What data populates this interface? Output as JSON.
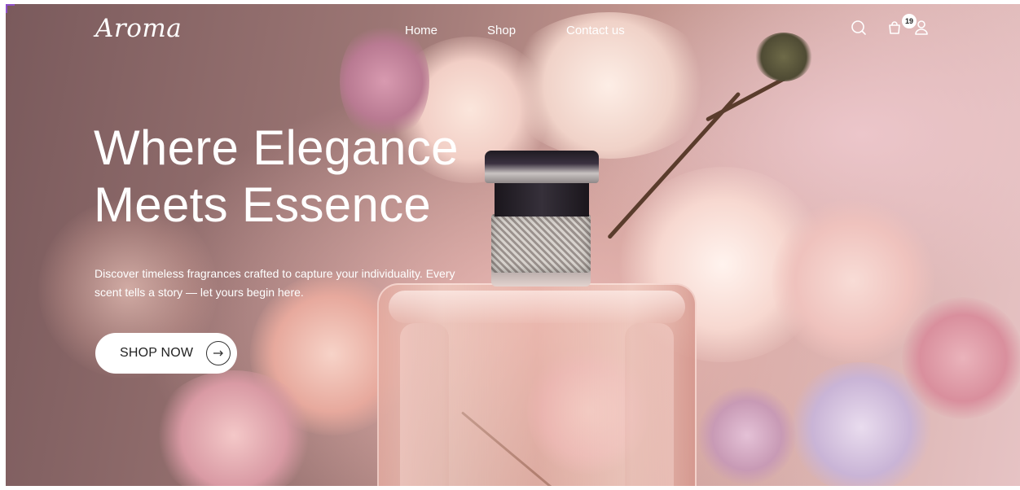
{
  "header": {
    "logo": "Aroma",
    "nav": [
      {
        "label": "Home"
      },
      {
        "label": "Shop"
      },
      {
        "label": "Contact us"
      }
    ],
    "cart_count": "19",
    "icons": {
      "search": "search-icon",
      "cart": "shopping-bag-icon",
      "account": "user-icon"
    }
  },
  "hero": {
    "headline": "Where Elegance\nMeets Essence",
    "subtext": "Discover timeless fragrances crafted to capture your individuality. Every scent tells a story — let yours begin here.",
    "cta_label": "SHOP NOW",
    "cta_icon": "arrow-right-icon"
  },
  "colors": {
    "text": "#ffffff",
    "button_bg": "#ffffff",
    "button_text": "#222222"
  }
}
